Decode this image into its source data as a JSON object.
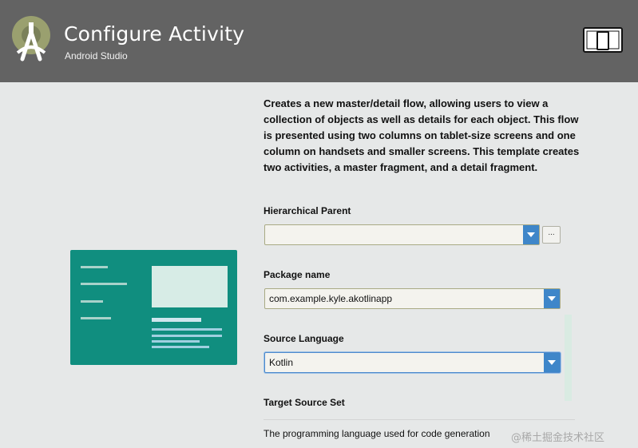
{
  "header": {
    "title": "Configure Activity",
    "subtitle": "Android Studio"
  },
  "description": "Creates a new master/detail flow, allowing users to view a collection of objects as well as details for each object. This flow is presented using two columns on tablet-size screens and one column on handsets and smaller screens. This template creates two activities, a master fragment, and a detail fragment.",
  "fields": {
    "hierarchical_parent": {
      "label": "Hierarchical Parent",
      "value": ""
    },
    "browse_label": "...",
    "package_name": {
      "label": "Package name",
      "value": "com.example.kyle.akotlinapp"
    },
    "source_language": {
      "label": "Source Language",
      "value": "Kotlin"
    },
    "target_source_set": {
      "label": "Target Source Set"
    }
  },
  "footer": {
    "hint": "The programming language used for code generation"
  },
  "watermark": "@稀土掘金技术社区",
  "colors": {
    "header_bg": "#636363",
    "preview_bg": "#108e7f",
    "combo_arrow": "#3e86c9"
  },
  "icons": {
    "logo": "android-studio-logo-icon",
    "device": "tablet-phone-icon"
  }
}
